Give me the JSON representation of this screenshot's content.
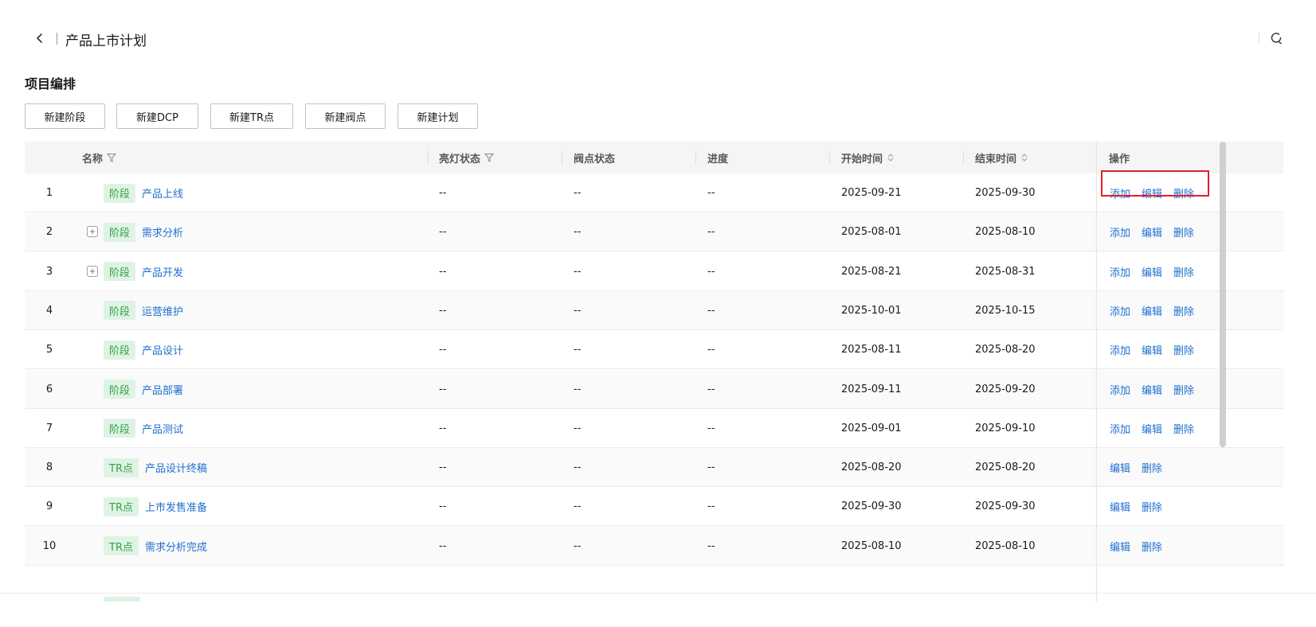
{
  "header": {
    "title": "产品上市计划",
    "back_icon": "chevron-left-icon",
    "refresh_icon": "refresh-icon"
  },
  "section": {
    "title": "项目编排"
  },
  "toolbar": {
    "buttons": [
      "新建阶段",
      "新建DCP",
      "新建TR点",
      "新建阀点",
      "新建计划"
    ]
  },
  "table": {
    "columns": {
      "name": "名称",
      "light_status": "亮灯状态",
      "valve_status": "阀点状态",
      "progress": "进度",
      "start": "开始时间",
      "end": "结束时间",
      "ops": "操作"
    },
    "actions": {
      "add": "添加",
      "edit": "编辑",
      "delete": "删除"
    },
    "rows": [
      {
        "index": "1",
        "expandable": false,
        "tag": "阶段",
        "name": "产品上线",
        "light": "--",
        "valve": "--",
        "progress": "--",
        "start": "2025-09-21",
        "end": "2025-09-30",
        "has_add": true
      },
      {
        "index": "2",
        "expandable": true,
        "tag": "阶段",
        "name": "需求分析",
        "light": "--",
        "valve": "--",
        "progress": "--",
        "start": "2025-08-01",
        "end": "2025-08-10",
        "has_add": true
      },
      {
        "index": "3",
        "expandable": true,
        "tag": "阶段",
        "name": "产品开发",
        "light": "--",
        "valve": "--",
        "progress": "--",
        "start": "2025-08-21",
        "end": "2025-08-31",
        "has_add": true
      },
      {
        "index": "4",
        "expandable": false,
        "tag": "阶段",
        "name": "运营维护",
        "light": "--",
        "valve": "--",
        "progress": "--",
        "start": "2025-10-01",
        "end": "2025-10-15",
        "has_add": true
      },
      {
        "index": "5",
        "expandable": false,
        "tag": "阶段",
        "name": "产品设计",
        "light": "--",
        "valve": "--",
        "progress": "--",
        "start": "2025-08-11",
        "end": "2025-08-20",
        "has_add": true
      },
      {
        "index": "6",
        "expandable": false,
        "tag": "阶段",
        "name": "产品部署",
        "light": "--",
        "valve": "--",
        "progress": "--",
        "start": "2025-09-11",
        "end": "2025-09-20",
        "has_add": true
      },
      {
        "index": "7",
        "expandable": false,
        "tag": "阶段",
        "name": "产品测试",
        "light": "--",
        "valve": "--",
        "progress": "--",
        "start": "2025-09-01",
        "end": "2025-09-10",
        "has_add": true
      },
      {
        "index": "8",
        "expandable": false,
        "tag": "TR点",
        "name": "产品设计终稿",
        "light": "--",
        "valve": "--",
        "progress": "--",
        "start": "2025-08-20",
        "end": "2025-08-20",
        "has_add": false
      },
      {
        "index": "9",
        "expandable": false,
        "tag": "TR点",
        "name": "上市发售准备",
        "light": "--",
        "valve": "--",
        "progress": "--",
        "start": "2025-09-30",
        "end": "2025-09-30",
        "has_add": false
      },
      {
        "index": "10",
        "expandable": false,
        "tag": "TR点",
        "name": "需求分析完成",
        "light": "--",
        "valve": "--",
        "progress": "--",
        "start": "2025-08-10",
        "end": "2025-08-10",
        "has_add": false
      }
    ]
  },
  "colors": {
    "link": "#1f6fd1",
    "tag_bg": "#dff3e4",
    "tag_text": "#32a045",
    "highlight": "#e0202a"
  }
}
